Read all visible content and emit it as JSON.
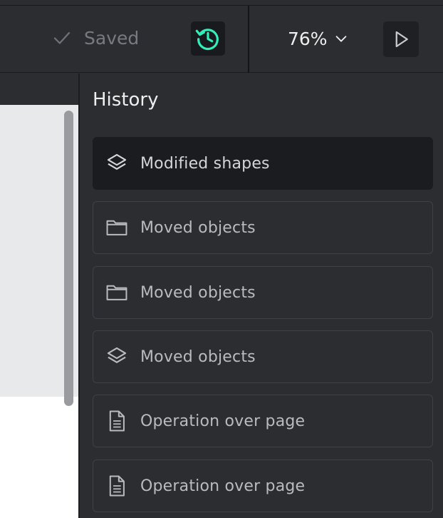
{
  "toolbar": {
    "saved_label": "Saved",
    "zoom_label": "76%",
    "icons": {
      "saved": "check-icon",
      "history": "history-icon",
      "zoom": "chevron-down-icon",
      "play": "play-icon"
    },
    "accent_color": "#31efb8"
  },
  "history": {
    "title": "History",
    "entries": [
      {
        "label": "Modified shapes",
        "icon": "layers-icon",
        "active": true
      },
      {
        "label": "Moved objects",
        "icon": "folder-icon",
        "active": false
      },
      {
        "label": "Moved objects",
        "icon": "folder-icon",
        "active": false
      },
      {
        "label": "Moved objects",
        "icon": "layers-icon",
        "active": false
      },
      {
        "label": "Operation over page",
        "icon": "page-icon",
        "active": false
      },
      {
        "label": "Operation over page",
        "icon": "page-icon",
        "active": false
      }
    ]
  }
}
